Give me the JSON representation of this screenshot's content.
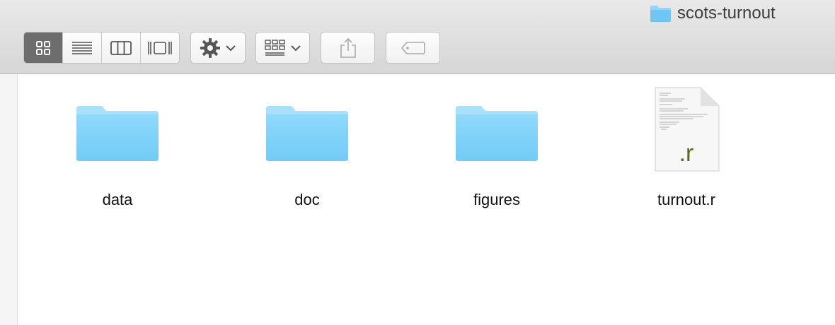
{
  "window": {
    "title": "scots-turnout"
  },
  "toolbar": {
    "view_buttons": [
      {
        "name": "icon-view-icon",
        "active": true
      },
      {
        "name": "list-view-icon",
        "active": false
      },
      {
        "name": "column-view-icon",
        "active": false
      },
      {
        "name": "cover-flow-view-icon",
        "active": false
      }
    ],
    "buttons": [
      "action-gear-icon",
      "arrange-icon",
      "share-icon",
      "tag-icon"
    ]
  },
  "files": [
    {
      "name": "data",
      "kind": "folder"
    },
    {
      "name": "doc",
      "kind": "folder"
    },
    {
      "name": "figures",
      "kind": "folder"
    },
    {
      "name": "turnout.r",
      "kind": "file",
      "badge": ".r"
    }
  ],
  "colors": {
    "folder": "#7fd0f7",
    "r_badge": "#5b6b12"
  }
}
